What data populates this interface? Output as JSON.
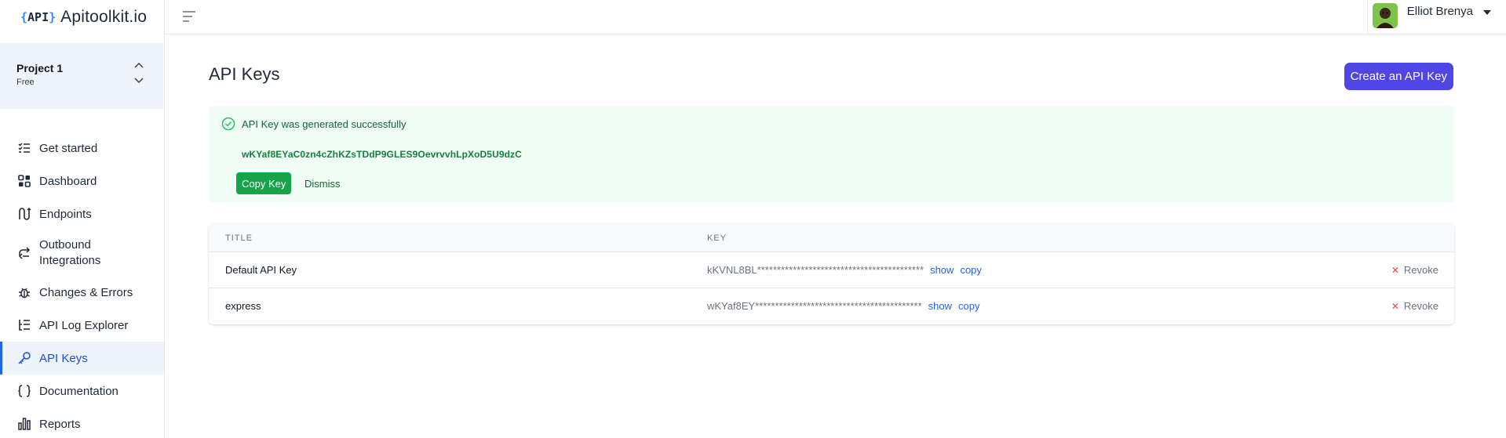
{
  "brand": {
    "mark_open": "{",
    "mark_text": "API",
    "mark_close": "}",
    "name": "Apitoolkit.io"
  },
  "project": {
    "name": "Project 1",
    "plan": "Free"
  },
  "sidebar": {
    "items": [
      {
        "label": "Get started",
        "icon": "checklist-icon"
      },
      {
        "label": "Dashboard",
        "icon": "grid-icon"
      },
      {
        "label": "Endpoints",
        "icon": "route-icon"
      },
      {
        "label": "Outbound Integrations",
        "icon": "outbound-icon"
      },
      {
        "label": "Changes & Errors",
        "icon": "bug-icon"
      },
      {
        "label": "API Log Explorer",
        "icon": "list-tree-icon"
      },
      {
        "label": "API Keys",
        "icon": "key-icon",
        "active": true
      },
      {
        "label": "Documentation",
        "icon": "braces-icon"
      },
      {
        "label": "Reports",
        "icon": "bar-chart-icon"
      }
    ]
  },
  "topbar": {
    "user_name": "Elliot Brenya"
  },
  "main": {
    "title": "API Keys",
    "create_button": "Create an API Key",
    "alert": {
      "title": "API Key was generated successfully",
      "key": "wKYaf8EYaC0zn4cZhKZsTDdP9GLES9OevrvvhLpXoD5U9dzC",
      "copy_button": "Copy Key",
      "dismiss_button": "Dismiss"
    },
    "table": {
      "headers": {
        "title": "TITLE",
        "key": "KEY"
      },
      "rows": [
        {
          "title": "Default API Key",
          "key": "kKVNL8BL******************************************",
          "show": "show",
          "copy": "copy",
          "revoke": "Revoke"
        },
        {
          "title": "express",
          "key": "wKYaf8EY******************************************",
          "show": "show",
          "copy": "copy",
          "revoke": "Revoke"
        }
      ]
    }
  },
  "colors": {
    "accent": "#4f46e5",
    "success": "#16a34a",
    "active_nav": "#2563eb",
    "danger": "#ef4444"
  }
}
